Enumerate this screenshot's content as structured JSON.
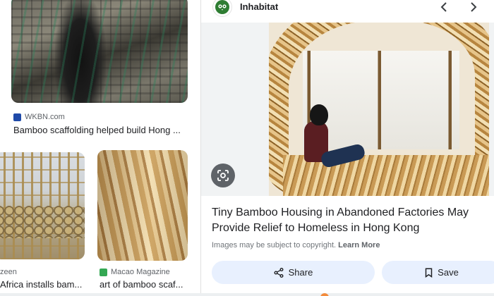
{
  "results": [
    {
      "source": "WKBN.com",
      "caption": "Bamboo scaffolding helped build Hong ..."
    },
    {
      "source": "zeen",
      "caption": "Africa installs bam..."
    },
    {
      "source": "Macao Magazine",
      "caption": "art of bamboo scaf..."
    }
  ],
  "panel": {
    "site_name": "Inhabitat",
    "title": "Tiny Bamboo Housing in Abandoned Factories May Provide Relief to Homeless in Hong Kong",
    "copyright_text": "Images may be subject to copyright.",
    "learn_more_label": "Learn More",
    "share_label": "Share",
    "save_label": "Save"
  },
  "icons": {
    "prev": "chevron-left-icon",
    "next": "chevron-right-icon",
    "lens": "google-lens-icon",
    "share": "share-icon",
    "save": "bookmark-icon"
  },
  "colors": {
    "action_button_bg": "#e8f0fe",
    "site_logo_green": "#2e7d32",
    "text_primary": "#202124",
    "text_secondary": "#70757a"
  }
}
